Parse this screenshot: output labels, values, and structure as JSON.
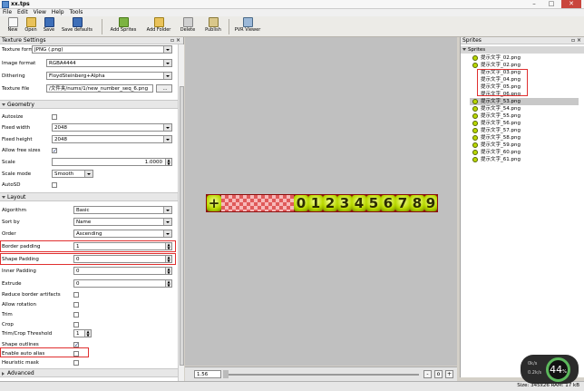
{
  "window": {
    "title": "xx.tps",
    "minimize": "–",
    "maximize": "□",
    "close": "✕"
  },
  "menu": [
    "File",
    "Edit",
    "View",
    "Help",
    "Tools"
  ],
  "toolbar": [
    {
      "label": "New",
      "icon": "new-document-icon",
      "color": "#f8f8f8"
    },
    {
      "label": "Open",
      "icon": "folder-open-icon",
      "color": "#e9c25a"
    },
    {
      "label": "Save",
      "icon": "save-disk-icon",
      "color": "#3e6fb8"
    },
    {
      "label": "Save defaults",
      "icon": "save-defaults-icon",
      "color": "#3e6fb8"
    },
    {
      "label": "Add Sprites",
      "icon": "add-sprites-icon",
      "color": "#7cb342"
    },
    {
      "label": "Add Folder",
      "icon": "add-folder-icon",
      "color": "#e9c25a"
    },
    {
      "label": "Delete",
      "icon": "delete-icon",
      "color": "#d0d0d0"
    },
    {
      "label": "Publish",
      "icon": "publish-icon",
      "color": "#d9c78a"
    },
    {
      "label": "PVR Viewer",
      "icon": "pvr-viewer-icon",
      "color": "#9bb8d8"
    }
  ],
  "left": {
    "panel_title": "Texture Settings",
    "texture_format_label": "Texture format",
    "texture_format_value": "JPNG (.png)",
    "image_format_label": "Image format",
    "image_format_value": "RGBA4444",
    "dithering_label": "Dithering",
    "dithering_value": "FloydSteinberg+Alpha",
    "texture_file_label": "Texture file",
    "texture_file_value": "/文件夹/nums/1/new_number_seq_6.png",
    "browse_label": "...",
    "geometry": "Geometry",
    "autosize_label": "Autosize",
    "fixed_width_label": "Fixed width",
    "fixed_width_value": "2048",
    "fixed_height_label": "Fixed height",
    "fixed_height_value": "2048",
    "allow_free_label": "Allow free sizes",
    "scale_label": "Scale",
    "scale_value": "1.0000",
    "scale_mode_label": "Scale mode",
    "scale_mode_value": "Smooth",
    "auto_sd_label": "AutoSD",
    "layout": "Layout",
    "algorithm_label": "Algorithm",
    "algorithm_value": "Basic",
    "sort_by_label": "Sort by",
    "sort_by_value": "Name",
    "order_label": "Order",
    "order_value": "Ascending",
    "border_padding_label": "Border padding",
    "border_padding_value": "1",
    "shape_padding_label": "Shape Padding",
    "shape_padding_value": "0",
    "inner_padding_label": "Inner Padding",
    "inner_padding_value": "0",
    "extrude_label": "Extrude",
    "extrude_value": "0",
    "reduce_border_label": "Reduce border artifacts",
    "allow_rotation_label": "Allow rotation",
    "trim_label": "Trim",
    "crop_label": "Crop",
    "trim_threshold_label": "Trim/Crop Threshold",
    "trim_threshold_value": "1",
    "shape_outlines_label": "Shape outlines",
    "enable_alias_label": "Enable auto alias",
    "heuristic_mask_label": "Heuristic mask",
    "advanced": "Advanced",
    "check": "✓"
  },
  "canvas": {
    "zoom_value": "1.56",
    "glyphs": [
      "+",
      "",
      "",
      "",
      "",
      "",
      "0",
      "1",
      "2",
      "3",
      "4",
      "5",
      "6",
      "7",
      "8",
      "9"
    ]
  },
  "right": {
    "panel_title": "Sprites",
    "root": "Sprites",
    "sprites": [
      "提示文字_02.png",
      "提示文字_02.png",
      "提示文字_03.png",
      "提示文字_04.png",
      "提示文字_05.png",
      "提示文字_06.png",
      "提示文字_53.png",
      "提示文字_54.png",
      "提示文字_55.png",
      "提示文字_56.png",
      "提示文字_57.png",
      "提示文字_58.png",
      "提示文字_59.png",
      "提示文字_60.png",
      "提示文字_61.png"
    ]
  },
  "status": "Size: 345x26 RAM: 17 kB",
  "widget": {
    "value": "44",
    "unit": "%",
    "up": "0k/s",
    "down": "0.2k/s"
  },
  "colors": {
    "highlight": "#e03030",
    "sprite_bg": "#8b0f0f",
    "glyph": "#b9d800"
  }
}
